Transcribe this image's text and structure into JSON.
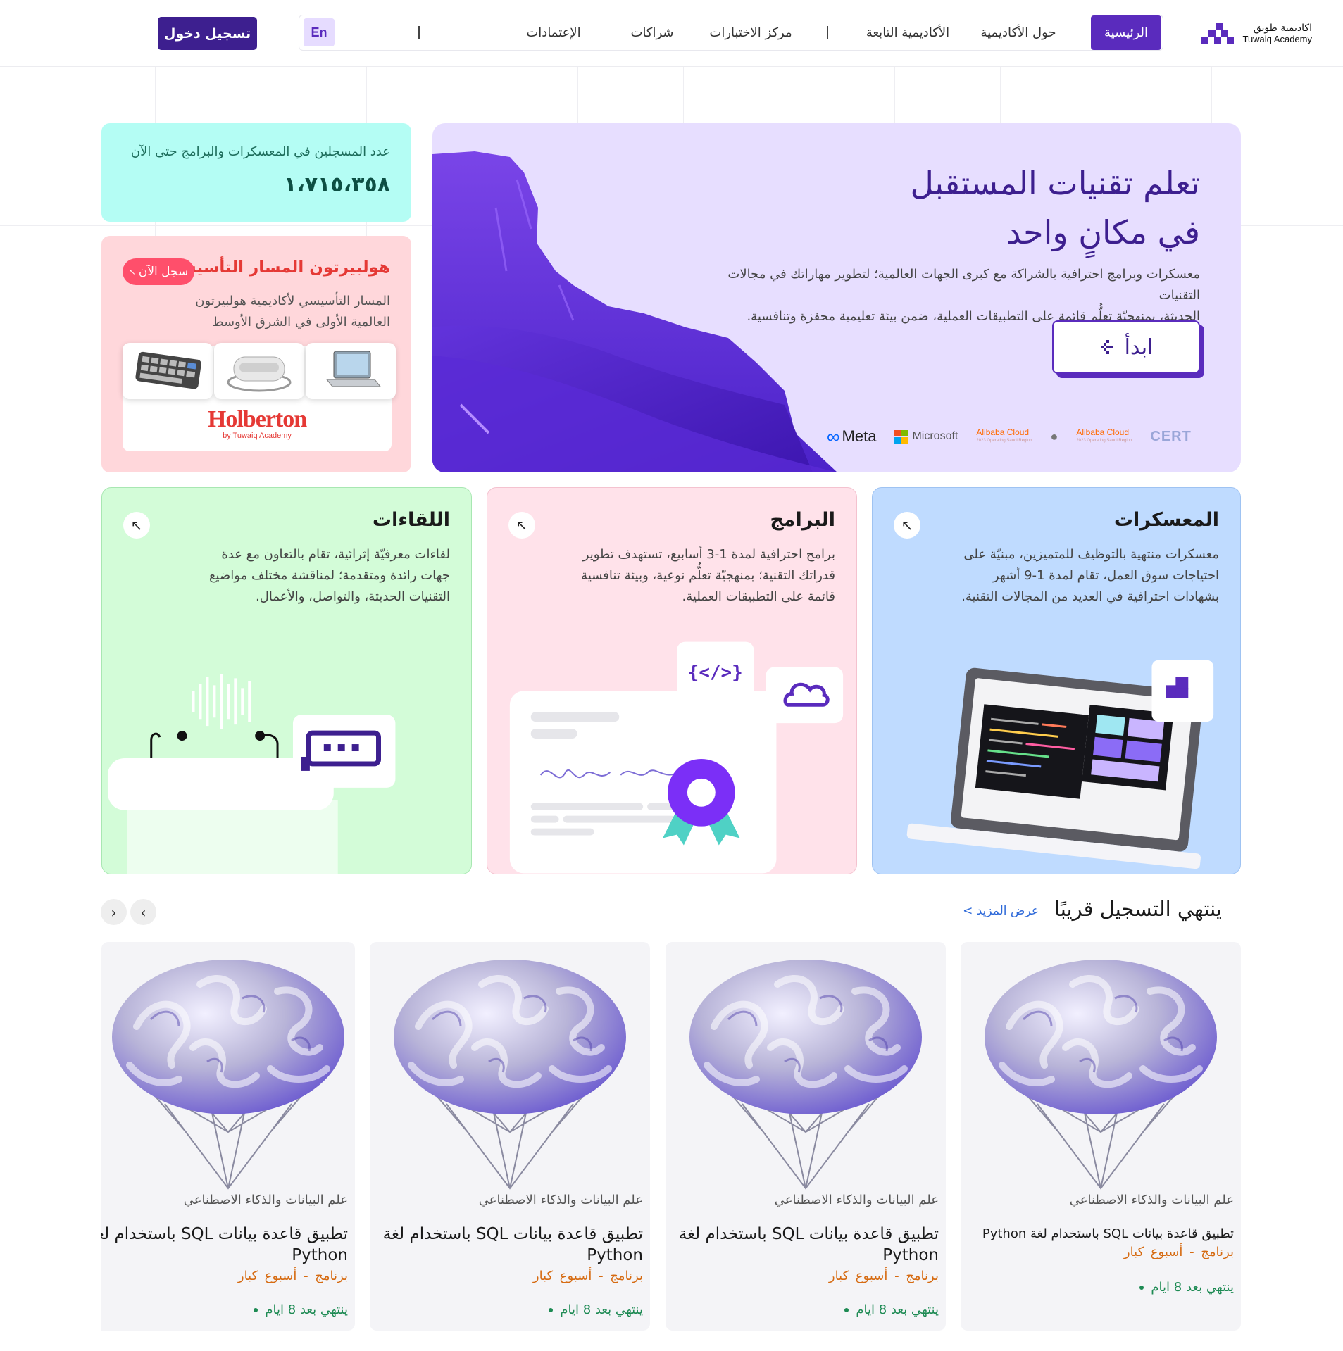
{
  "header": {
    "logo_ar": "اكاديمية طويق",
    "logo_en": "Tuwaiq Academy",
    "nav": [
      "الرئيسية",
      "حول الأكاديمية",
      "الأكاديمية التابعة",
      "مركز الاختبارات",
      "شراكات",
      "الإعتمادات"
    ],
    "lang": "En",
    "login": "تسجيل دخول",
    "accent": "#5a2bbd"
  },
  "hero": {
    "title_line1": "تعلم تقنيات المستقبل",
    "title_line2": "في مكانٍ واحد",
    "desc_line1": "معسكرات وبرامج احترافية بالشراكة مع كبرى الجهات العالمية؛ لتطوير مهاراتك في مجالات التقنيات",
    "desc_line2": "الحديثة، بمنهجيّة تعلُّم قائمة على التطبيقات العملية، ضمن بيئة تعليمية محفزة وتنافسية.",
    "cta": "ابدأ",
    "partners": {
      "meta": "Meta",
      "microsoft": "Microsoft",
      "alibaba": "Alibaba Cloud",
      "alibaba_sub": "2023 Operating Saudi Region",
      "cert": "CERT"
    }
  },
  "stat": {
    "label": "عدد المسجلين في المعسكرات والبرامج حتى الآن",
    "value": "١،٧١٥،٣٥٨"
  },
  "holberton": {
    "title": "هولبيرتون المسار التأسيسي",
    "badge": "سجل الآن",
    "desc_line1": "المسار التأسيسي لأكاديمية هولبيرتون",
    "desc_line2": "العالمية الأولى في الشرق الأوسط",
    "logo": "Holberton",
    "logo_sub": "by Tuwaiq Academy"
  },
  "categories": [
    {
      "title": "المعسكرات",
      "desc": "معسكرات منتهية بالتوظيف للمتميزين، مبنيّة على احتياجات سوق العمل، تقام لمدة 1-9 أشهر بشهادات احترافية في العديد من المجالات التقنية.",
      "color": "#bfdbff"
    },
    {
      "title": "البرامج",
      "desc": "برامج احترافية لمدة 1-3 أسابيع، تستهدف تطوير قدراتك التقنية؛ بمنهجيّة تعلُّم نوعية، وبيئة تنافسية قائمة على التطبيقات العملية.",
      "color": "#ffe2ea"
    },
    {
      "title": "اللقاءات",
      "desc": "لقاءات معرفيّة إثرائية، تقام بالتعاون مع عدة جهات رائدة ومتقدمة؛ لمناقشة مختلف مواضيع التقنيات الحديثة، والتواصل، والأعمال.",
      "color": "#d3fcd8"
    }
  ],
  "section": {
    "title": "ينتهي التسجيل قريبًا",
    "more": "عرض المزيد >",
    "prev": "‹",
    "next": "›"
  },
  "programs": [
    {
      "category": "علم البيانات والذكاء الاصطناعي",
      "name": "تطبيق قاعدة بيانات SQL باستخدام لغة Python",
      "meta": "برنامج - أسبوع   كبار",
      "ends": "ينتهي بعد 8 ايام"
    },
    {
      "category": "علم البيانات والذكاء الاصطناعي",
      "name": "تطبيق قاعدة بيانات SQL باستخدام لغة Python",
      "meta": "برنامج - أسبوع   كبار",
      "ends": "ينتهي بعد 8 ايام"
    },
    {
      "category": "علم البيانات والذكاء الاصطناعي",
      "name": "تطبيق قاعدة بيانات SQL باستخدام لغة Python",
      "meta": "برنامج - أسبوع   كبار",
      "ends": "ينتهي بعد 8 ايام"
    },
    {
      "category": "علم البيانات والذكاء الاصطناعي",
      "name": "تطبيق قاعدة بيانات SQL باستخدام لغة Python",
      "meta": "برنامج - أسبوع   كبار",
      "ends": "ينتهي بعد 8 ايام"
    }
  ]
}
